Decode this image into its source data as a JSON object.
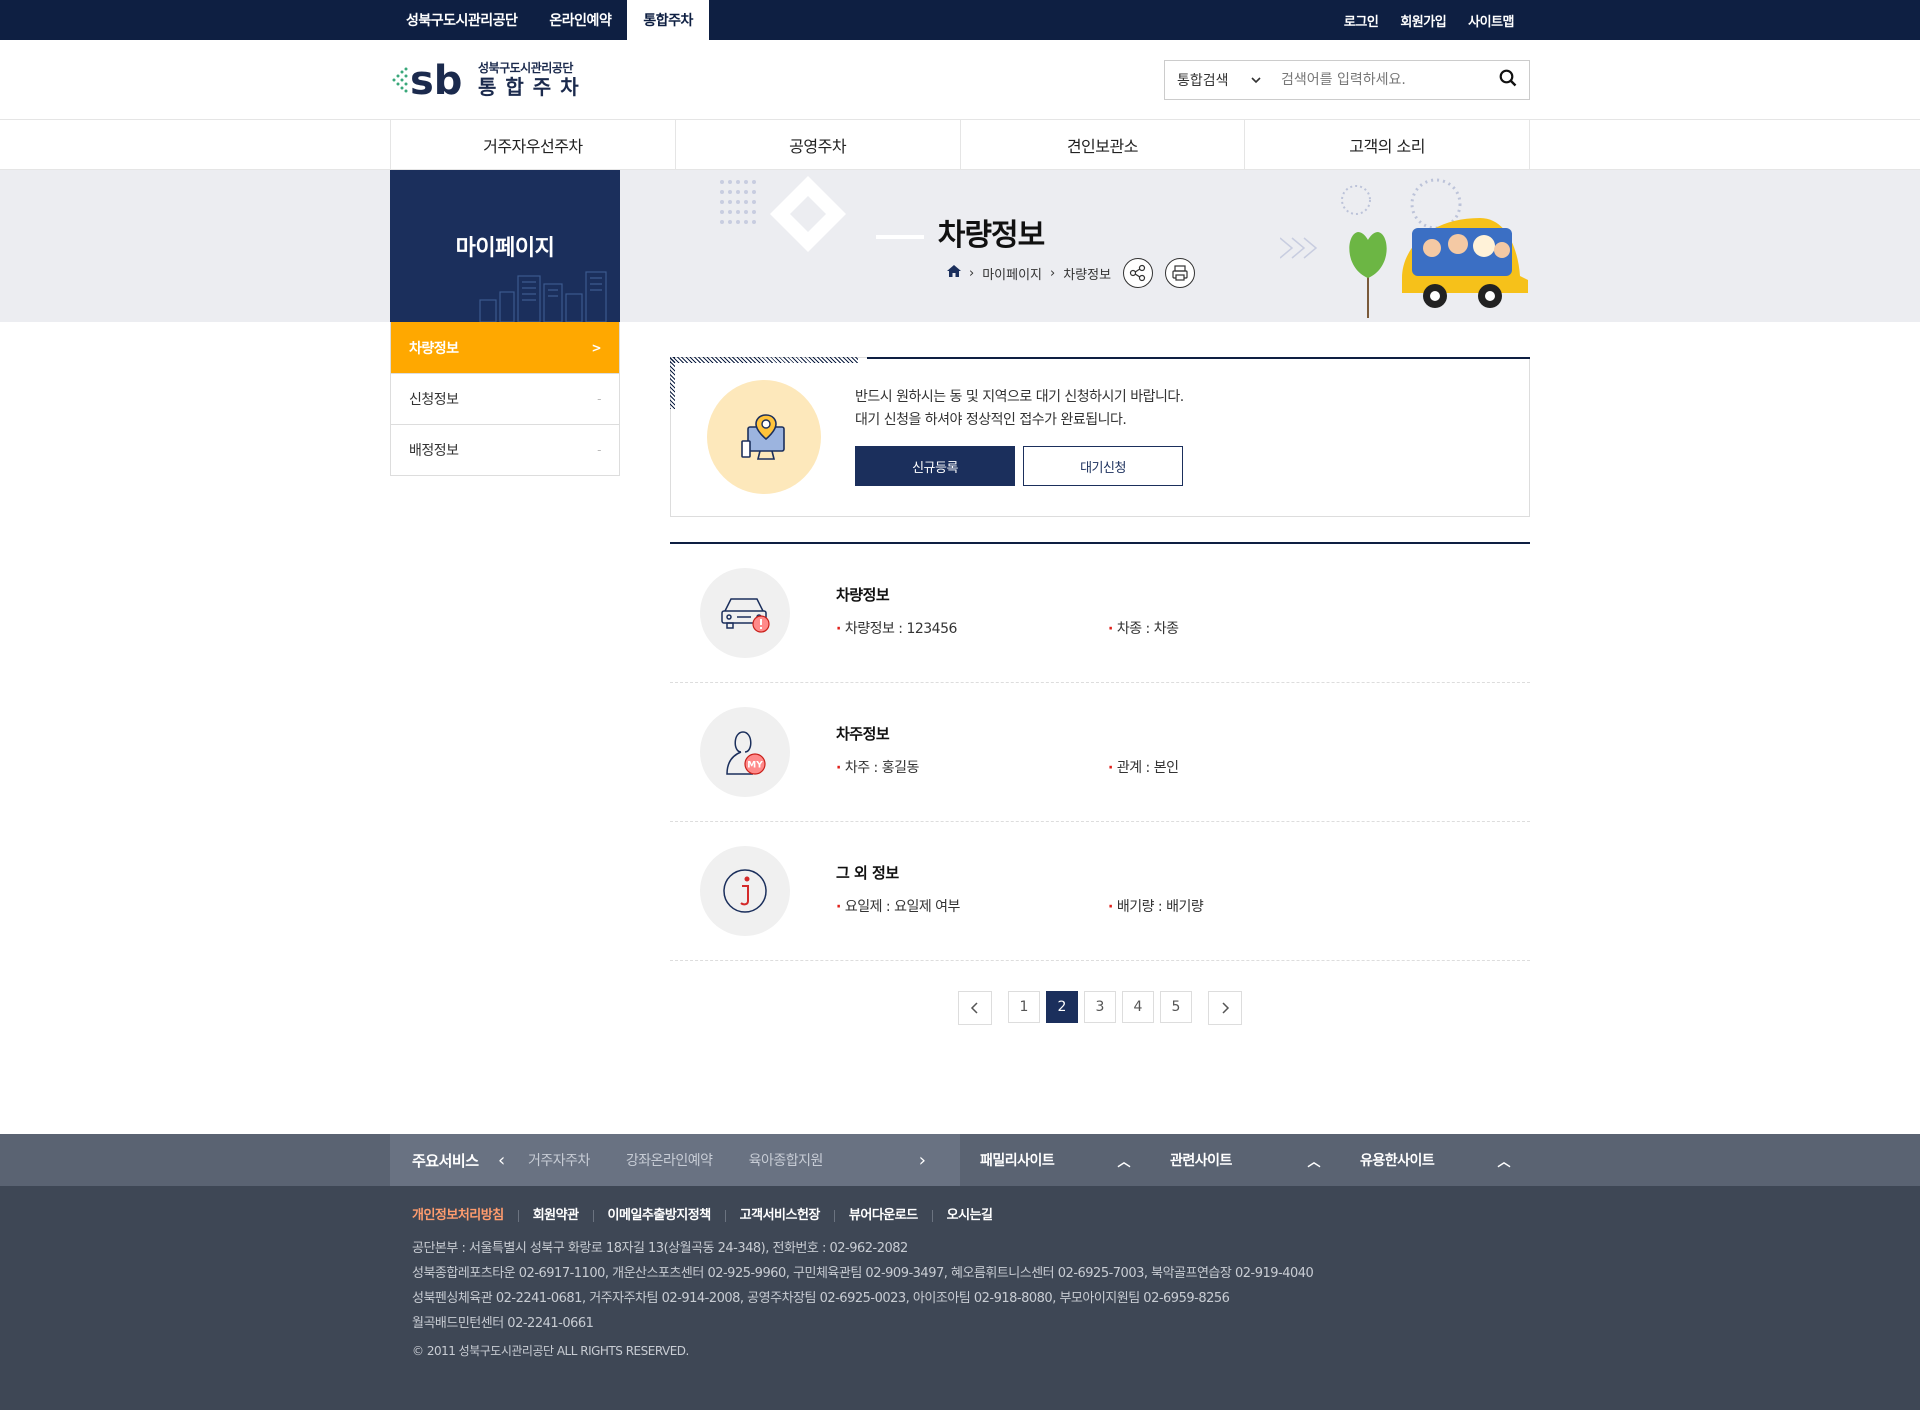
{
  "topbar": {
    "left": [
      "성북구도시관리공단",
      "온라인예약",
      "통합주차"
    ],
    "right": [
      "로그인",
      "회원가입",
      "사이트맵"
    ]
  },
  "header": {
    "logo_small": "성북구도시관리공단",
    "logo_big": "통합주차",
    "logo_mark": "sb",
    "search_select": "통합검색",
    "search_placeholder": "검색어를 입력하세요."
  },
  "gnb": [
    "거주자우선주차",
    "공영주차",
    "견인보관소",
    "고객의 소리"
  ],
  "visual": {
    "section_title": "마이페이지",
    "page_title": "차량정보",
    "breadcrumb": [
      "마이페이지",
      "차량정보"
    ]
  },
  "lnb": [
    {
      "label": "차량정보",
      "mark": ">"
    },
    {
      "label": "신청정보",
      "mark": "-"
    },
    {
      "label": "배정정보",
      "mark": "-"
    }
  ],
  "notice": {
    "line1": "반드시 원하시는 동 및 지역으로 대기 신청하시기 바랍니다.",
    "line2": "대기 신청을 하셔야 정상적인 접수가 완료됩니다.",
    "btn_new": "신규등록",
    "btn_wait": "대기신청"
  },
  "info": [
    {
      "title": "차량정보",
      "f1": "차량정보 : 123456",
      "f2": "차종 : 차종"
    },
    {
      "title": "차주정보",
      "f1": "차주 : 홍길동",
      "f2": "관계 : 본인"
    },
    {
      "title": "그 외 정보",
      "f1": "요일제 : 요일제 여부",
      "f2": "배기량 : 배기량"
    }
  ],
  "paging": {
    "pages": [
      "1",
      "2",
      "3",
      "4",
      "5"
    ],
    "current": "2"
  },
  "footer": {
    "main_title": "주요서비스",
    "main_items": [
      "거주자주차",
      "강좌온라인예약",
      "육아종합지원"
    ],
    "groups": [
      "패밀리사이트",
      "관련사이트",
      "유용한사이트"
    ],
    "links": [
      "개인정보처리방침",
      "회원약관",
      "이메일추출방지정책",
      "고객서비스헌장",
      "뷰어다운로드",
      "오시는길"
    ],
    "addr": [
      "공단본부 : 서울특별시 성북구 화랑로 18자길 13(상월곡동 24-348), 전화번호 : 02-962-2082",
      "성북종합레포츠타운 02-6917-1100, 개운산스포츠센터 02-925-9960, 구민체육관팀 02-909-3497, 혜오름휘트니스센터 02-6925-7003, 북악골프연습장 02-919-4040",
      "성북펜싱체육관 02-2241-0681, 거주자주차팀 02-914-2008, 공영주차장팀 02-6925-0023, 아이조아팀 02-918-8080, 부모아이지원팀 02-6959-8256",
      "월곡배드민턴센터 02-2241-0661"
    ],
    "copyright": "© 2011 성북구도시관리공단 ALL RIGHTS RESERVED."
  },
  "colors": {
    "navy": "#0e1f42",
    "accent": "#ffa800",
    "primary_btn": "#1b2f5c",
    "bullet": "#e0201a"
  }
}
